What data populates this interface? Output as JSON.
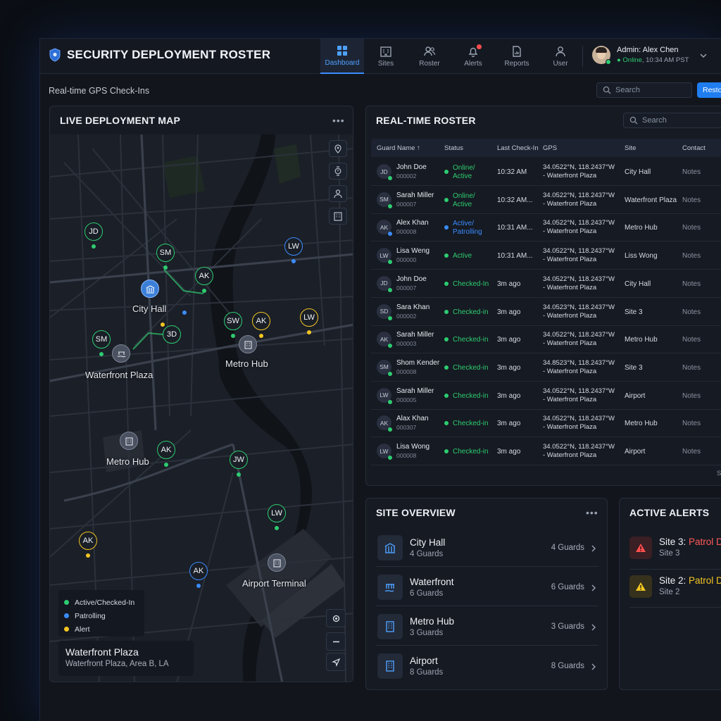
{
  "app": {
    "title": "SECURITY DEPLOYMENT ROSTER",
    "subtitle": "Real-time GPS Check-Ins"
  },
  "nav": [
    {
      "label": "Dashboard",
      "icon": "dashboard-icon",
      "active": true
    },
    {
      "label": "Sites",
      "icon": "sites-icon"
    },
    {
      "label": "Roster",
      "icon": "roster-icon"
    },
    {
      "label": "Alerts",
      "icon": "bell-icon",
      "badge": true
    },
    {
      "label": "Reports",
      "icon": "reports-icon"
    },
    {
      "label": "User",
      "icon": "user-icon"
    }
  ],
  "user": {
    "name": "Admin: Alex Chen",
    "status": "Online",
    "time": ", 10:34 AM PST"
  },
  "toolbar": {
    "search_placeholder": "Search",
    "button_label": "Restore"
  },
  "map": {
    "title": "LIVE DEPLOYMENT MAP",
    "menu": "•••",
    "pins": [
      {
        "initials": "JD",
        "status": "green"
      },
      {
        "initials": "SM",
        "status": "green"
      },
      {
        "initials": "AK",
        "status": "green"
      },
      {
        "initials": "LW",
        "status": "blue"
      },
      {
        "initials": "SW",
        "status": "green"
      },
      {
        "initials": "AK",
        "status": "yellow"
      },
      {
        "initials": "LW",
        "status": "yellow"
      },
      {
        "initials": "SM",
        "status": "green"
      },
      {
        "initials": "3D",
        "status": "green"
      },
      {
        "initials": "AK",
        "status": "green"
      },
      {
        "initials": "JW",
        "status": "green"
      },
      {
        "initials": "LW",
        "status": "green"
      },
      {
        "initials": "AK",
        "status": "yellow"
      },
      {
        "initials": "AK",
        "status": "blue"
      }
    ],
    "places": [
      "City Hall",
      "Waterfront Plaza",
      "Metro Hub",
      "Metro Hub",
      "Airport Terminal"
    ],
    "legend": [
      {
        "label": "Active/Checked-In",
        "color": "#2ecc71"
      },
      {
        "label": "Patrolling",
        "color": "#3b8cff"
      },
      {
        "label": "Alert",
        "color": "#f3c623"
      }
    ],
    "location": {
      "title": "Waterfront Plaza",
      "subtitle": "Waterfront Plaza, Area B, LA"
    }
  },
  "roster": {
    "title": "REAL-TIME ROSTER",
    "search_placeholder": "Search",
    "columns": [
      "Guard Name ↑",
      "Status",
      "Last Check-In",
      "GPS",
      "Site",
      "Contact"
    ],
    "rows": [
      {
        "initials": "JD",
        "name": "John Doe",
        "id": "000002",
        "status": "Online/ Active",
        "status_color": "#2ecc71",
        "checkin": "10:32 AM",
        "gps1": "34.0522°N, 118.2437°W",
        "gps2": "- Waterfront Plaza",
        "site": "City Hall",
        "contact": "Notes"
      },
      {
        "initials": "SM",
        "name": "Sarah Miller",
        "id": "000007",
        "status": "Online/ Active",
        "status_color": "#2ecc71",
        "checkin": "10:32 AM...",
        "gps1": "34.0522°N, 118.2437°W",
        "gps2": "- Waterfront Plaza",
        "site": "Waterfront Plaza",
        "contact": "Notes"
      },
      {
        "initials": "AK",
        "name": "Alex Khan",
        "id": "000008",
        "status": "Active/ Patrolling",
        "status_color": "#3b8cff",
        "checkin": "10:31 AM...",
        "gps1": "34.0522°N, 118.2437°W",
        "gps2": "- Waterfront Plaza",
        "site": "Metro Hub",
        "contact": "Notes"
      },
      {
        "initials": "LW",
        "name": "Lisa Weng",
        "id": "000000",
        "status": "Active",
        "status_color": "#2ecc71",
        "checkin": "10:31 AM...",
        "gps1": "34.0522°N, 118.2437°W",
        "gps2": "- Waterfront Plaza",
        "site": "Liss Wong",
        "contact": "Notes"
      },
      {
        "initials": "JD",
        "name": "John Doe",
        "id": "000007",
        "status": "Checked-In",
        "status_color": "#2ecc71",
        "checkin": "3m ago",
        "gps1": "34.0522°N, 118.2437°W",
        "gps2": "- Waterfront Plaza",
        "site": "City Hall",
        "contact": "Notes"
      },
      {
        "initials": "SD",
        "name": "Sara Khan",
        "id": "000002",
        "status": "Checked-in",
        "status_color": "#2ecc71",
        "checkin": "3m ago",
        "gps1": "34.0523°N, 118.2437°W",
        "gps2": "- Waterfront Plaza",
        "site": "Site 3",
        "contact": "Notes"
      },
      {
        "initials": "AK",
        "name": "Sarah Miller",
        "id": "000003",
        "status": "Checked-in",
        "status_color": "#2ecc71",
        "checkin": "3m ago",
        "gps1": "34.0522°N, 118.2437°W",
        "gps2": "- Waterfront Plaza",
        "site": "Metro Hub",
        "contact": "Notes"
      },
      {
        "initials": "SM",
        "name": "Shom Kender",
        "id": "000008",
        "status": "Checked-in",
        "status_color": "#2ecc71",
        "checkin": "3m ago",
        "gps1": "34.8523°N, 118.2437°W",
        "gps2": "- Waterfront Plaza",
        "site": "Site 3",
        "contact": "Notes"
      },
      {
        "initials": "LW",
        "name": "Sarah Miller",
        "id": "000005",
        "status": "Checked-in",
        "status_color": "#2ecc71",
        "checkin": "3m ago",
        "gps1": "34.0522°N, 118.2437°W",
        "gps2": "- Waterfront Plaza",
        "site": "Airport",
        "contact": "Notes"
      },
      {
        "initials": "AK",
        "name": "Alax Khan",
        "id": "000307",
        "status": "Checked-in",
        "status_color": "#2ecc71",
        "checkin": "3m ago",
        "gps1": "34.0522°N, 118.2437°W",
        "gps2": "- Waterfront Plaza",
        "site": "Metro Hub",
        "contact": "Notes"
      },
      {
        "initials": "LW",
        "name": "Lisa Wong",
        "id": "000008",
        "status": "Checked-in",
        "status_color": "#2ecc71",
        "checkin": "3m ago",
        "gps1": "34.0522°N, 118.2437°W",
        "gps2": "- Waterfront Plaza",
        "site": "Airport",
        "contact": "Notes"
      }
    ],
    "footer": "Sh"
  },
  "sites": {
    "title": "SITE OVERVIEW",
    "menu": "•••",
    "items": [
      {
        "name": "City Hall",
        "count": "4 Guards",
        "guards": "4 Guards",
        "icon": "city-hall-icon"
      },
      {
        "name": "Waterfront",
        "count": "6 Guards",
        "guards": "6 Guards",
        "icon": "waterfront-icon"
      },
      {
        "name": "Metro Hub",
        "count": "3 Guards",
        "guards": "3 Guards",
        "icon": "building-icon"
      },
      {
        "name": "Airport",
        "count": "8 Guards",
        "guards": "8 Guards",
        "icon": "building-icon"
      }
    ]
  },
  "alerts": {
    "title": "ACTIVE ALERTS",
    "items": [
      {
        "site": "Site 3: ",
        "type": "Patrol D",
        "sub": "Site 3",
        "color": "#ff5a5a",
        "bg": "#3a1f24"
      },
      {
        "site": "Site 2: ",
        "type": "Patrol D",
        "sub": "Site 2",
        "color": "#f3c623",
        "bg": "#36311c"
      }
    ]
  }
}
